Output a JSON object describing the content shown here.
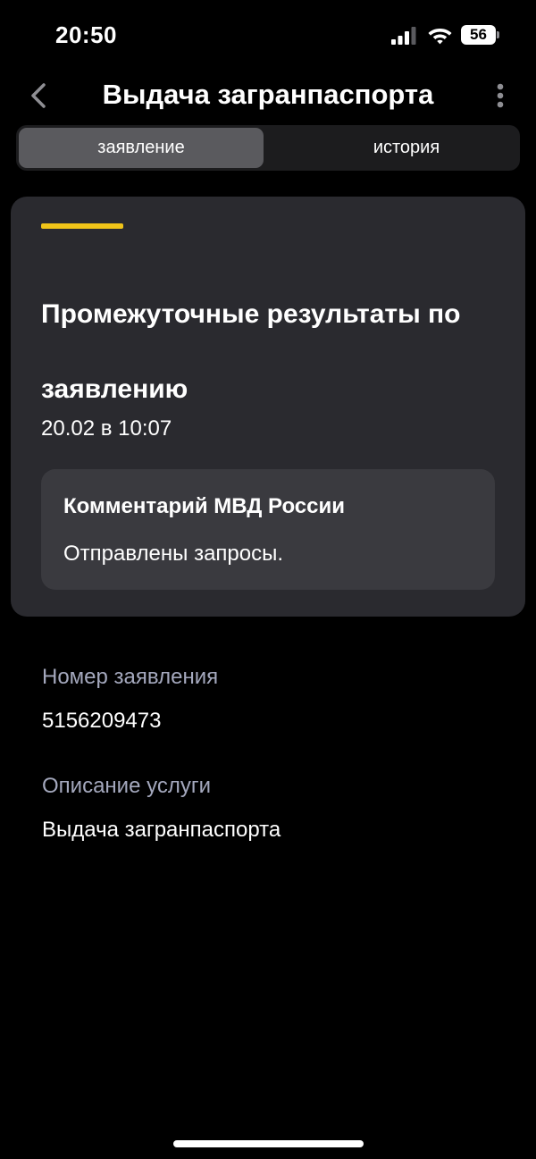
{
  "status_bar": {
    "time": "20:50",
    "battery_level": "56"
  },
  "header": {
    "title": "Выдача загранпаспорта",
    "back_icon": "chevron-left-icon",
    "more_icon": "vertical-dots-icon"
  },
  "tabs": [
    {
      "label": "заявление",
      "active": true
    },
    {
      "label": "история",
      "active": false
    }
  ],
  "status_card": {
    "accent_color": "#f0c419",
    "title": "Промежуточные результаты по заявлению",
    "date": "20.02 в 10:07",
    "comment": {
      "title": "Комментарий МВД России",
      "text": "Отправлены запросы."
    }
  },
  "details": {
    "application_number_label": "Номер заявления",
    "application_number": "5156209473",
    "service_description_label": "Описание услуги",
    "service_description": "Выдача загранпаспорта"
  },
  "colors": {
    "background": "#000000",
    "card": "#2a2a2f",
    "comment_box": "#3a3a3f",
    "label": "#a4a8bd",
    "active_tab": "#5a5a5e"
  }
}
